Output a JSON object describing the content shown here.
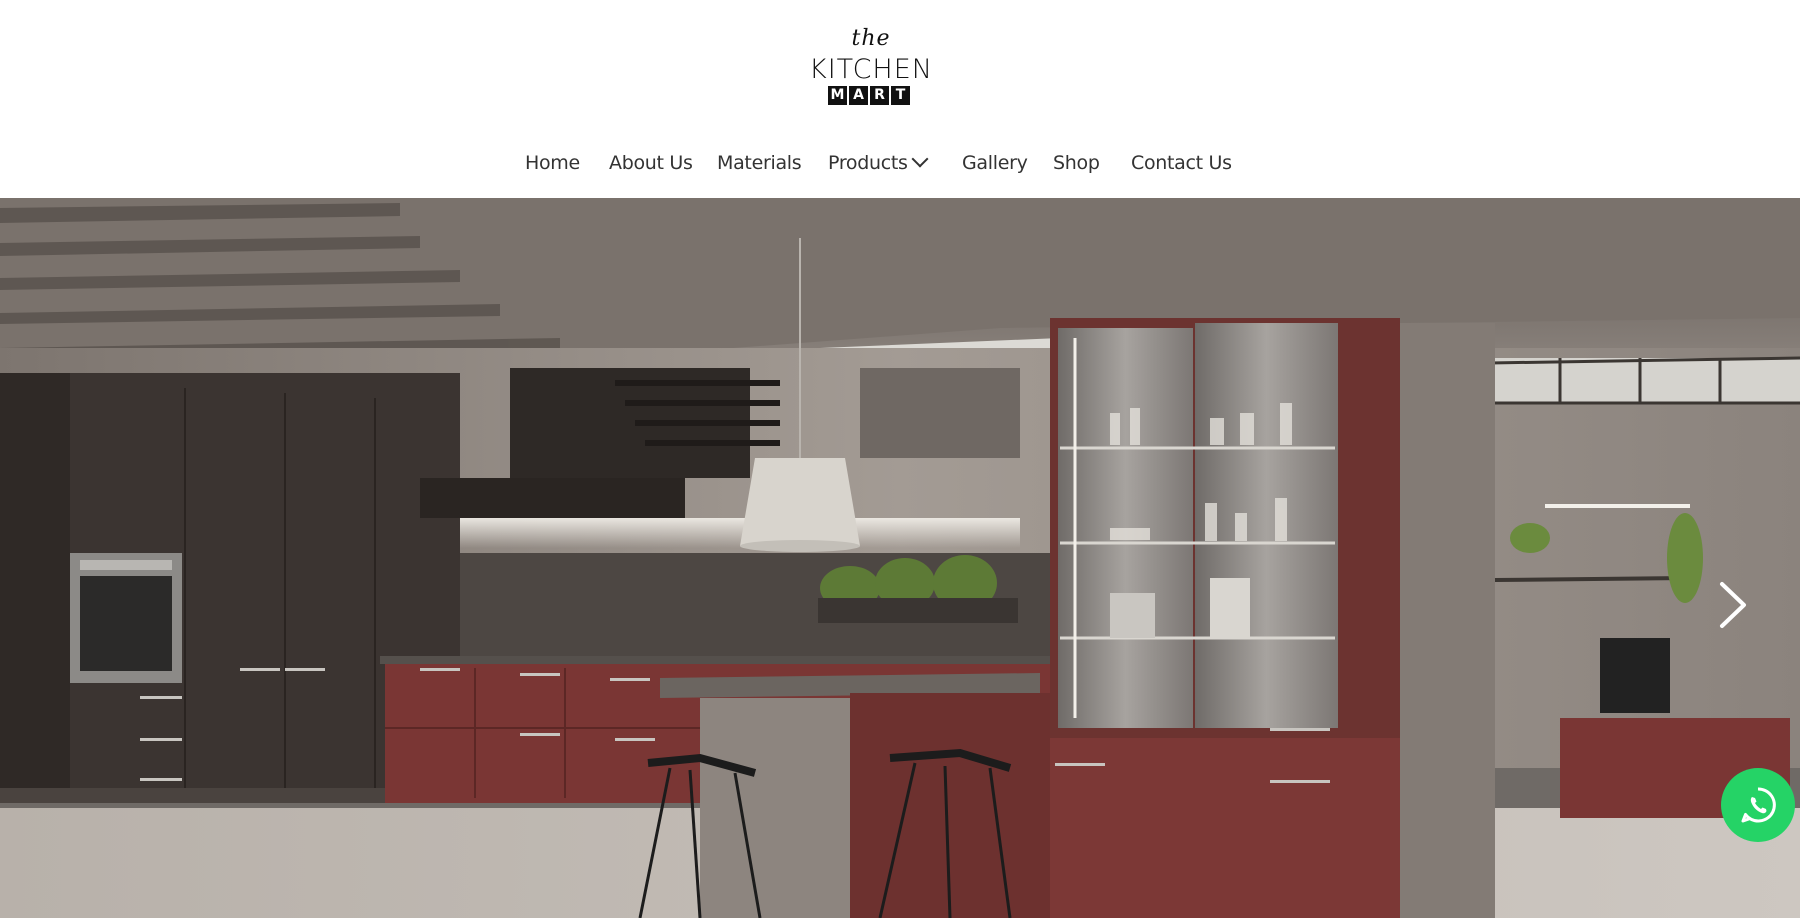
{
  "logo": {
    "the": "the",
    "main": "KITCHEN",
    "sub": [
      "M",
      "A",
      "R",
      "T"
    ]
  },
  "nav": {
    "items": [
      {
        "label": "Home"
      },
      {
        "label": "About Us"
      },
      {
        "label": "Materials"
      },
      {
        "label": "Products",
        "has_dropdown": true
      },
      {
        "label": "Gallery"
      },
      {
        "label": "Shop"
      },
      {
        "label": "Contact Us"
      }
    ]
  },
  "hero": {
    "icons": {
      "next": "chevron-right-icon",
      "whatsapp": "whatsapp-icon"
    }
  },
  "colors": {
    "whatsapp": "#25d366",
    "cabinet_red": "#7a3634",
    "dark_wood": "#3a3330",
    "wall": "#8a827c"
  }
}
